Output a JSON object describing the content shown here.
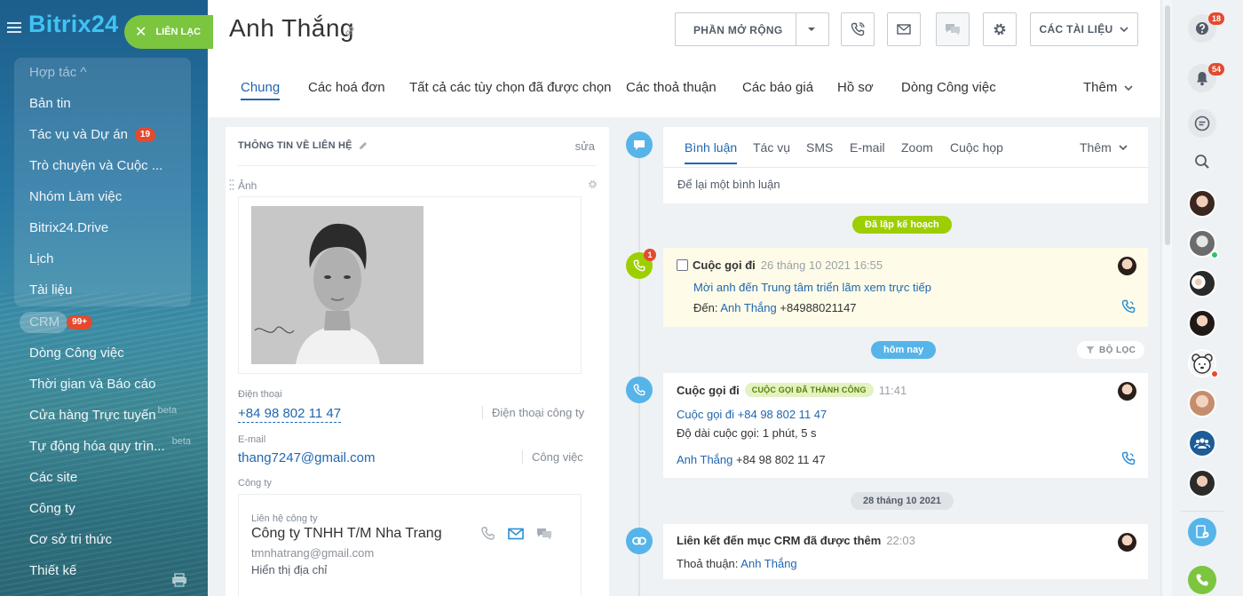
{
  "sidebar": {
    "brand": "Bitrix24",
    "contact_button": "LIÊN LẠC",
    "items": [
      {
        "label": "Hợp tác ^"
      },
      {
        "label": "Bản tin"
      },
      {
        "label": "Tác vụ và Dự án",
        "badge": "19"
      },
      {
        "label": "Trò chuyện và Cuộc ..."
      },
      {
        "label": "Nhóm Làm việc"
      },
      {
        "label": "Bitrix24.Drive"
      },
      {
        "label": "Lịch"
      },
      {
        "label": "Tài liệu"
      },
      {
        "label": "CRM",
        "badge": "99+"
      },
      {
        "label": "Dòng Công việc"
      },
      {
        "label": "Thời gian và Báo cáo"
      },
      {
        "label": "Cửa hàng Trực tuyến",
        "sup": "beta"
      },
      {
        "label": "Tự động hóa quy trìn...",
        "sup": "beta"
      },
      {
        "label": "Các site"
      },
      {
        "label": "Công ty"
      },
      {
        "label": "Cơ sở tri thức"
      },
      {
        "label": "Thiết kế"
      }
    ]
  },
  "header": {
    "title": "Anh Thắng",
    "extensions_button": "PHẦN MỞ RỘNG",
    "documents_button": "CÁC TÀI LIỆU"
  },
  "tabs": {
    "items": [
      "Chung",
      "Các hoá đơn",
      "Tất cả các tùy chọn đã được chọn",
      "Các thoả thuận",
      "Các báo giá",
      "Hồ sơ",
      "Dòng Công việc"
    ],
    "more": "Thêm"
  },
  "contact": {
    "section_title": "THÔNG TIN VỀ LIÊN HỆ",
    "edit": "sửa",
    "photo_label": "Ảnh",
    "phone_label": "Điện thoại",
    "phone_value": "+84 98 802 11 47",
    "phone_type": "Điện thoại công ty",
    "email_label": "E-mail",
    "email_value": "thang7247@gmail.com",
    "email_type": "Công việc",
    "company_label": "Công ty",
    "company": {
      "label": "Liên hệ công ty",
      "name": "Công ty TNHH T/M Nha Trang",
      "email": "tmnhatrang@gmail.com",
      "address_link": "Hiển thị địa chỉ"
    }
  },
  "comment_box": {
    "tabs": [
      "Bình luận",
      "Tác vụ",
      "SMS",
      "E-mail",
      "Zoom",
      "Cuộc họp"
    ],
    "more": "Thêm",
    "placeholder": "Để lại một bình luận"
  },
  "timeline": {
    "planned_label": "Đã lập kế hoạch",
    "today_label": "hôm nay",
    "filter_label": "BỘ LỌC",
    "date_label": "28 tháng 10 2021",
    "planned_badge": "1",
    "planned_item": {
      "title": "Cuộc gọi đi",
      "time": "26 tháng 10 2021 16:55",
      "subject": "Mời anh đến Trung tâm triển lãm xem trực tiếp",
      "to_label": "Đến:",
      "to_name": "Anh Thắng",
      "to_phone": "+84988021147"
    },
    "call_item": {
      "title": "Cuộc gọi đi",
      "status": "CUỘC GỌI ĐÃ THÀNH CÔNG",
      "time": "11:41",
      "call_link": "Cuộc gọi đi +84 98 802 11 47",
      "duration": "Độ dài cuộc gọi: 1 phút, 5 s",
      "contact_name": "Anh Thắng",
      "contact_phone": "+84 98 802 11 47"
    },
    "link_item": {
      "title": "Liên kết đến mục CRM đã được thêm",
      "time": "22:03",
      "deal_label": "Thoả thuận:",
      "deal_name": "Anh Thắng"
    }
  },
  "rail": {
    "help_badge": "18",
    "notifications_badge": "54"
  },
  "colors": {
    "accent_blue": "#2067b0",
    "green": "#9dcf00",
    "light_blue": "#56b4e9",
    "badge_red": "#e34a2f"
  }
}
